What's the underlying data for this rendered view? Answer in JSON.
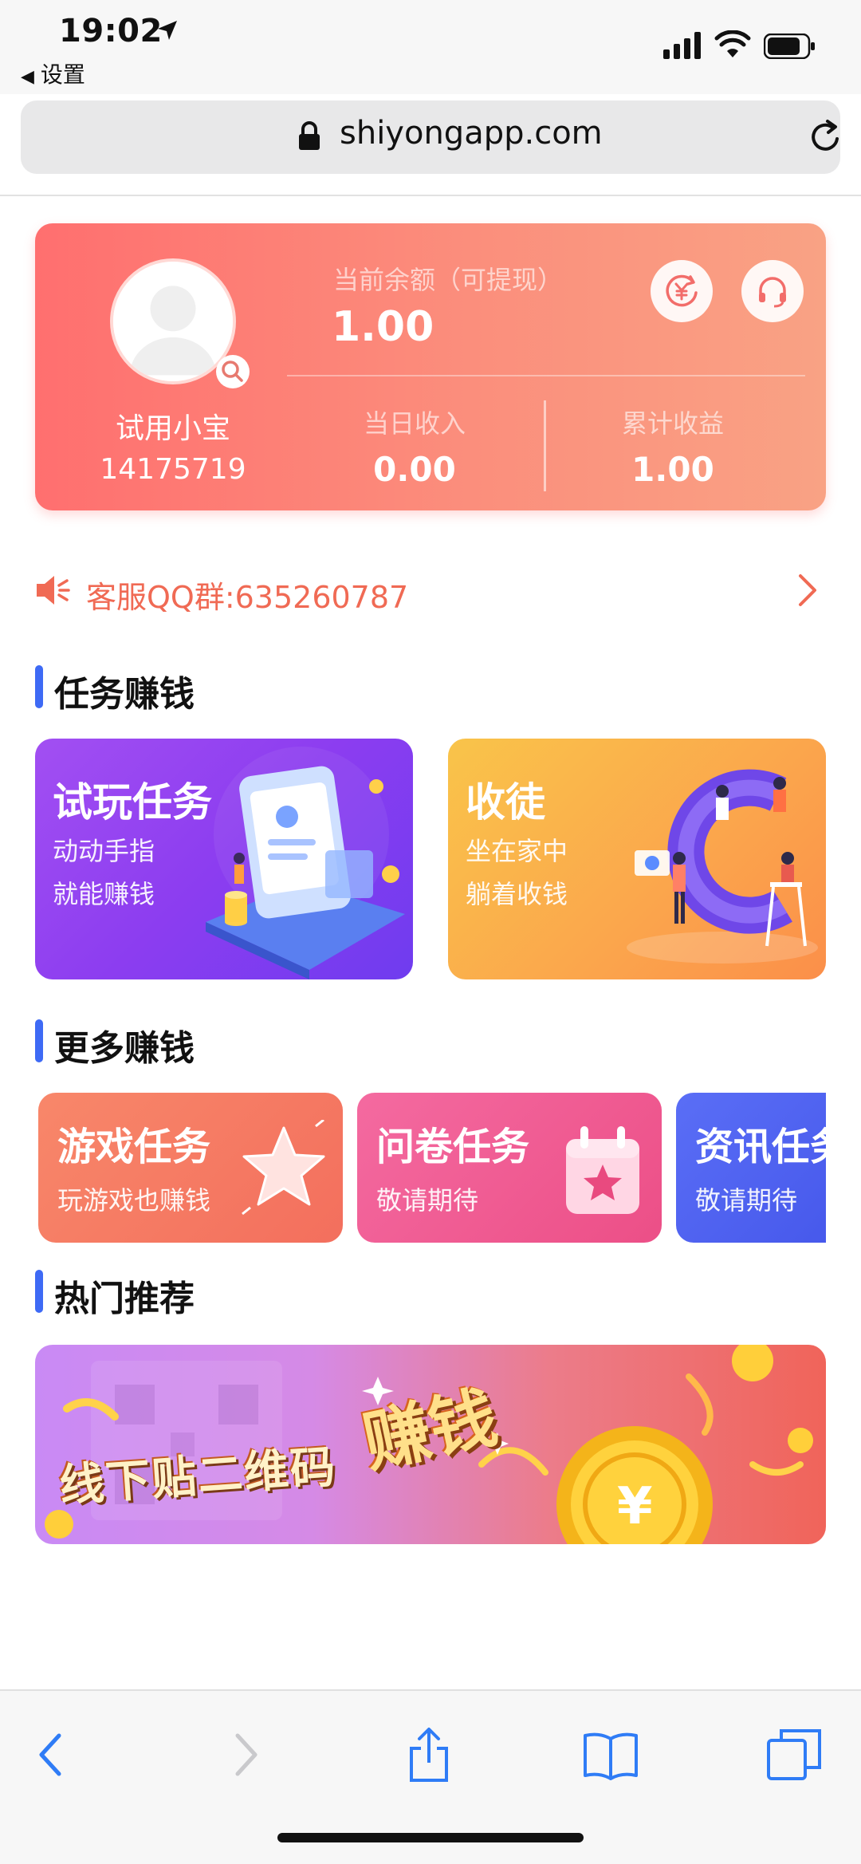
{
  "status_bar": {
    "time": "19:02",
    "back_app": "设置"
  },
  "browser": {
    "url": "shiyongapp.com"
  },
  "profile": {
    "nickname": "试用小宝",
    "user_id": "14175719",
    "balance_label": "当前余额（可提现）",
    "balance_value": "1.00",
    "today_label": "当日收入",
    "today_value": "0.00",
    "total_label": "累计收益",
    "total_value": "1.00"
  },
  "notice": {
    "text": "客服QQ群:635260787"
  },
  "sections": {
    "tasks": "任务赚钱",
    "more": "更多赚钱",
    "hot": "热门推荐"
  },
  "task_cards": [
    {
      "title": "试玩任务",
      "line1": "动动手指",
      "line2": "就能赚钱"
    },
    {
      "title": "收徒",
      "line1": "坐在家中",
      "line2": "躺着收钱"
    }
  ],
  "more_cards": [
    {
      "title": "游戏任务",
      "sub": "玩游戏也赚钱"
    },
    {
      "title": "问卷任务",
      "sub": "敬请期待"
    },
    {
      "title": "资讯任务",
      "sub": "敬请期待"
    }
  ],
  "banner": {
    "main": "线下贴二维码",
    "big": "赚钱"
  },
  "colors": {
    "accent_blue": "#3e6af5",
    "profile_gradient_start": "#ff6f6f",
    "profile_gradient_end": "#f9a284",
    "notice_red": "#f06a54"
  },
  "icons": {
    "location": "location-arrow-icon",
    "lock": "lock-icon",
    "reload": "reload-icon",
    "yuan": "yuan-icon",
    "service": "headset-icon",
    "speaker": "speaker-icon",
    "chevron": "chevron-right-icon",
    "toolbar": [
      "back-icon",
      "forward-icon",
      "share-icon",
      "bookmarks-icon",
      "tabs-icon"
    ]
  }
}
